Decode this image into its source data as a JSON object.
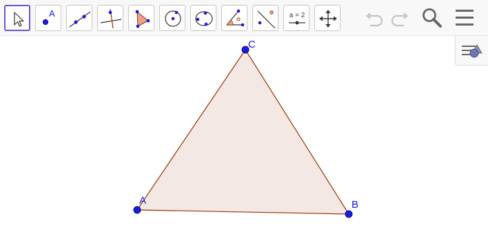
{
  "toolbar": {
    "tools": [
      {
        "name": "move",
        "icon": "move-cursor-icon",
        "selected": true
      },
      {
        "name": "point",
        "icon": "point-icon",
        "icon_text": "A"
      },
      {
        "name": "line",
        "icon": "line-icon"
      },
      {
        "name": "perpendicular-line",
        "icon": "perpendicular-line-icon"
      },
      {
        "name": "polygon",
        "icon": "polygon-icon"
      },
      {
        "name": "circle-center-point",
        "icon": "circle-with-center-icon"
      },
      {
        "name": "circle-three-points",
        "icon": "circle-through-points-icon"
      },
      {
        "name": "angle",
        "icon": "angle-icon"
      },
      {
        "name": "reflect-about-line",
        "icon": "reflect-icon"
      },
      {
        "name": "slider",
        "icon": "slider-icon",
        "icon_text": "a = 2"
      },
      {
        "name": "move-graphics-view",
        "icon": "move-view-icon"
      }
    ],
    "actions": [
      {
        "name": "undo",
        "icon": "undo-icon",
        "enabled": false
      },
      {
        "name": "redo",
        "icon": "redo-icon",
        "enabled": false
      },
      {
        "name": "search",
        "icon": "search-icon"
      },
      {
        "name": "menu",
        "icon": "hamburger-menu-icon"
      }
    ]
  },
  "style_bar_toggle": {
    "icon": "style-bar-icon"
  },
  "construction": {
    "points": [
      {
        "label": "A"
      },
      {
        "label": "B"
      },
      {
        "label": "C"
      }
    ],
    "polygon": {
      "vertices": [
        "A",
        "B",
        "C"
      ]
    }
  },
  "colors": {
    "accent": "#6557d2",
    "point": "#1a1ae6",
    "polygon_edge": "#993300",
    "polygon_fill": "#f3e8e4"
  }
}
